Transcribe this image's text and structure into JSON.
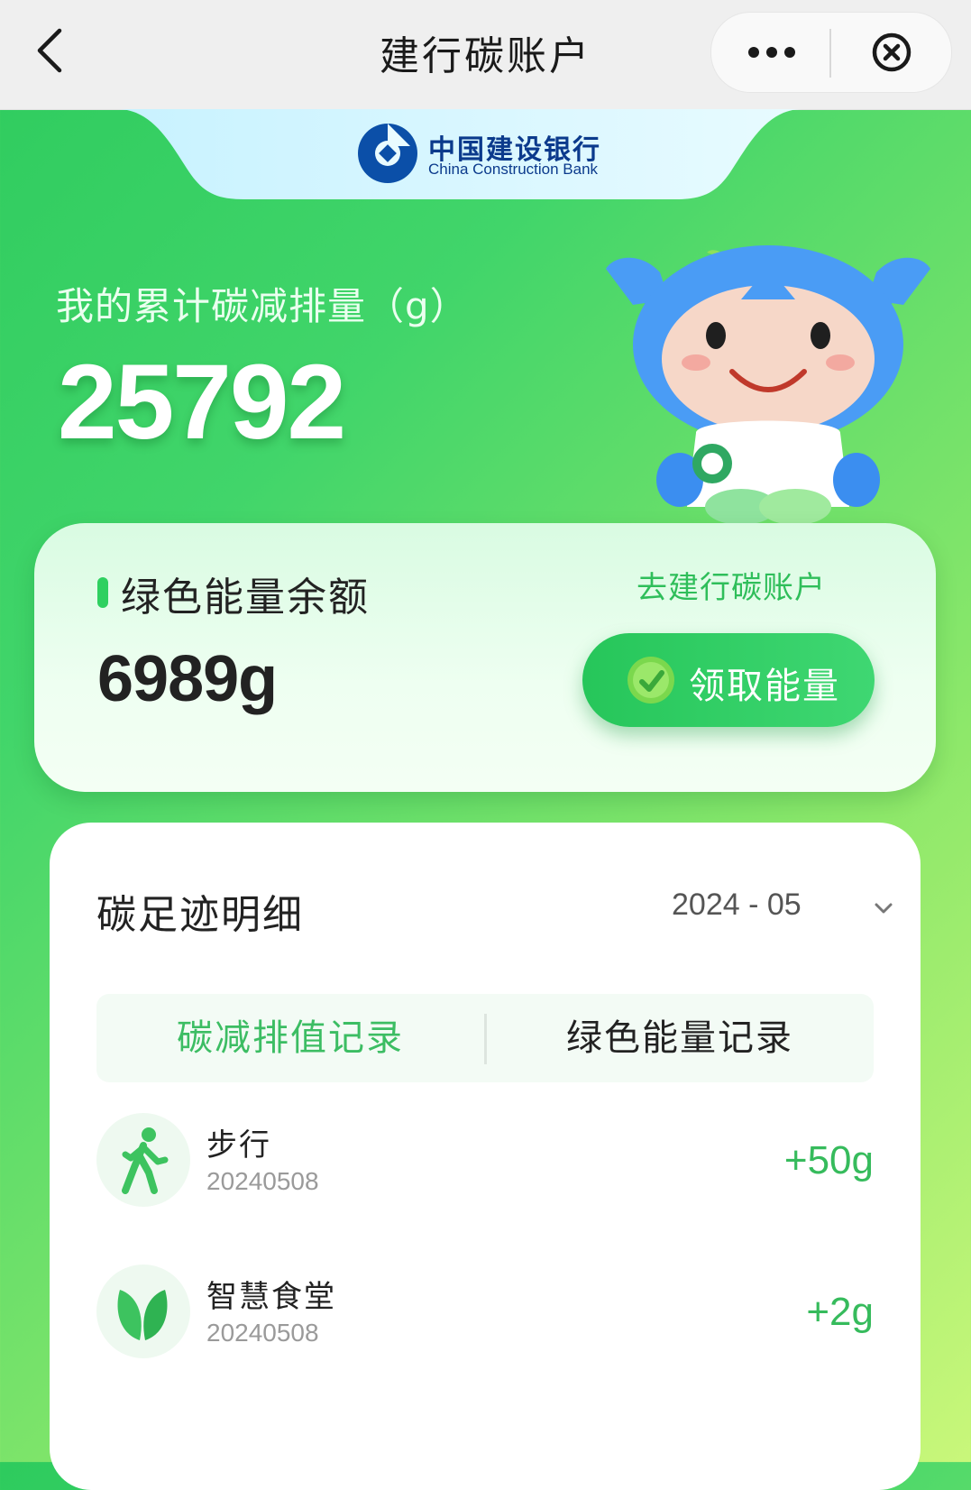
{
  "nav": {
    "title": "建行碳账户",
    "back_icon": "chevron-left-icon",
    "more_icon": "more-dots-icon",
    "close_icon": "close-circle-icon"
  },
  "bank": {
    "name_cn": "中国建设银行",
    "name_en": "China Construction Bank",
    "brand_color": "#0b3a8c"
  },
  "summary": {
    "cumulative_label": "我的累计碳减排量（g）",
    "cumulative_value": "25792"
  },
  "energy": {
    "label": "绿色能量余额",
    "value": "6989g",
    "go_link": "去建行碳账户",
    "claim_button": "领取能量",
    "accent_color": "#2fd060"
  },
  "footprint": {
    "title": "碳足迹明细",
    "month": "2024 - 05",
    "tabs": [
      {
        "label": "碳减排值记录",
        "active": true
      },
      {
        "label": "绿色能量记录",
        "active": false
      }
    ],
    "records": [
      {
        "name": "步行",
        "date": "20240508",
        "amount": "+50g",
        "icon": "walking-icon"
      },
      {
        "name": "智慧食堂",
        "date": "20240508",
        "amount": "+2g",
        "icon": "leaf-icon"
      }
    ]
  }
}
